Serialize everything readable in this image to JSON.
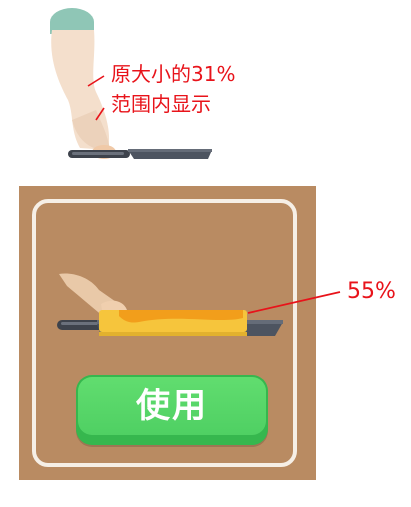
{
  "reference": {
    "annotation_line1": "原大小的31%",
    "annotation_line2": "范围内显示",
    "scale_percent": 31
  },
  "card": {
    "item_scale_label": "55%",
    "item_scale_percent": 55,
    "use_button_label": "使用"
  },
  "colors": {
    "annotation_red": "#e8131a",
    "card_background": "#b98b62",
    "card_border": "#f6efe6",
    "button_green": "#4fd063",
    "pan_gray": "#4d5460",
    "omelet_yellow": "#f6c53c",
    "omelet_orange": "#f29e1b",
    "arm_skin": "#f4dfcc",
    "chef_hat": "#8fc6b6"
  },
  "icons": {
    "reference_figure": "chef-arm-holding-pan-icon",
    "item_figure": "hand-holding-pan-with-omelet-icon"
  }
}
